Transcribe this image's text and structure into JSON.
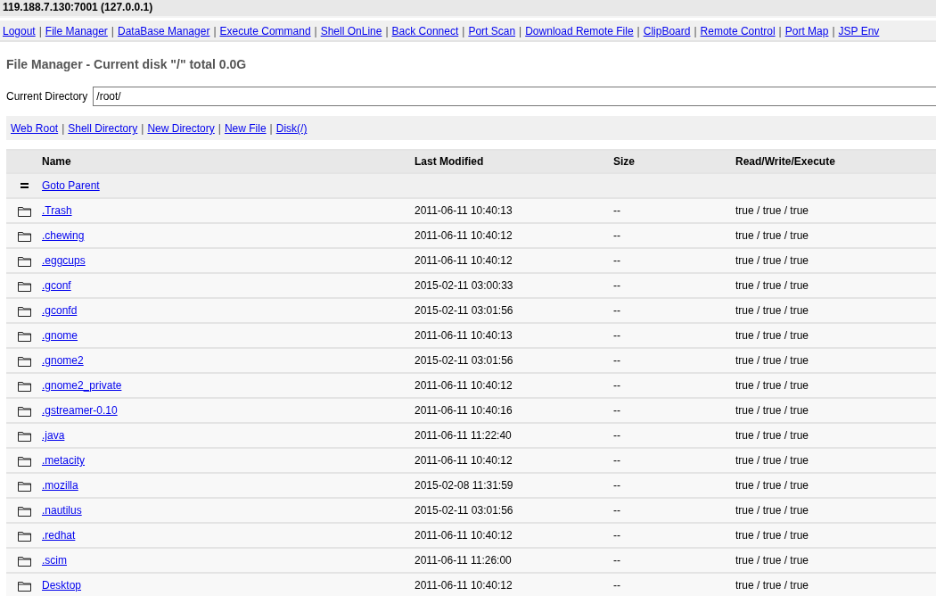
{
  "header": {
    "title": "119.188.7.130:7001 (127.0.0.1)"
  },
  "nav": {
    "separator": "|",
    "links": [
      "Logout",
      "File Manager",
      "DataBase Manager",
      "Execute Command",
      "Shell OnLine",
      "Back Connect",
      "Port Scan",
      "Download Remote File",
      "ClipBoard",
      "Remote Control",
      "Port Map",
      "JSP Env"
    ]
  },
  "heading": "File Manager - Current disk \"/\" total 0.0G",
  "current_directory": {
    "label": "Current Directory",
    "value": "/root/"
  },
  "toolbar": {
    "separator": "|",
    "links": [
      "Web Root",
      "Shell Directory",
      "New Directory",
      "New File",
      "Disk(/)"
    ]
  },
  "table": {
    "columns": [
      "Name",
      "Last Modified",
      "Size",
      "Read/Write/Execute"
    ],
    "parent_row": {
      "label": "Goto Parent"
    },
    "rows": [
      {
        "kind": "folder",
        "name": ".Trash",
        "modified": "2011-06-11 10:40:13",
        "size": "--",
        "permissions": "true / true / true"
      },
      {
        "kind": "folder",
        "name": ".chewing",
        "modified": "2011-06-11 10:40:12",
        "size": "--",
        "permissions": "true / true / true"
      },
      {
        "kind": "folder",
        "name": ".eggcups",
        "modified": "2011-06-11 10:40:12",
        "size": "--",
        "permissions": "true / true / true"
      },
      {
        "kind": "folder",
        "name": ".gconf",
        "modified": "2015-02-11 03:00:33",
        "size": "--",
        "permissions": "true / true / true"
      },
      {
        "kind": "folder",
        "name": ".gconfd",
        "modified": "2015-02-11 03:01:56",
        "size": "--",
        "permissions": "true / true / true"
      },
      {
        "kind": "folder",
        "name": ".gnome",
        "modified": "2011-06-11 10:40:13",
        "size": "--",
        "permissions": "true / true / true"
      },
      {
        "kind": "folder",
        "name": ".gnome2",
        "modified": "2015-02-11 03:01:56",
        "size": "--",
        "permissions": "true / true / true"
      },
      {
        "kind": "folder",
        "name": ".gnome2_private",
        "modified": "2011-06-11 10:40:12",
        "size": "--",
        "permissions": "true / true / true"
      },
      {
        "kind": "folder",
        "name": ".gstreamer-0.10",
        "modified": "2011-06-11 10:40:16",
        "size": "--",
        "permissions": "true / true / true"
      },
      {
        "kind": "folder",
        "name": ".java",
        "modified": "2011-06-11 11:22:40",
        "size": "--",
        "permissions": "true / true / true"
      },
      {
        "kind": "folder",
        "name": ".metacity",
        "modified": "2011-06-11 10:40:12",
        "size": "--",
        "permissions": "true / true / true"
      },
      {
        "kind": "folder",
        "name": ".mozilla",
        "modified": "2015-02-08 11:31:59",
        "size": "--",
        "permissions": "true / true / true"
      },
      {
        "kind": "folder",
        "name": ".nautilus",
        "modified": "2015-02-11 03:01:56",
        "size": "--",
        "permissions": "true / true / true"
      },
      {
        "kind": "folder",
        "name": ".redhat",
        "modified": "2011-06-11 10:40:12",
        "size": "--",
        "permissions": "true / true / true"
      },
      {
        "kind": "folder",
        "name": ".scim",
        "modified": "2011-06-11 11:26:00",
        "size": "--",
        "permissions": "true / true / true"
      },
      {
        "kind": "folder",
        "name": "Desktop",
        "modified": "2011-06-11 10:40:12",
        "size": "--",
        "permissions": "true / true / true"
      }
    ]
  }
}
